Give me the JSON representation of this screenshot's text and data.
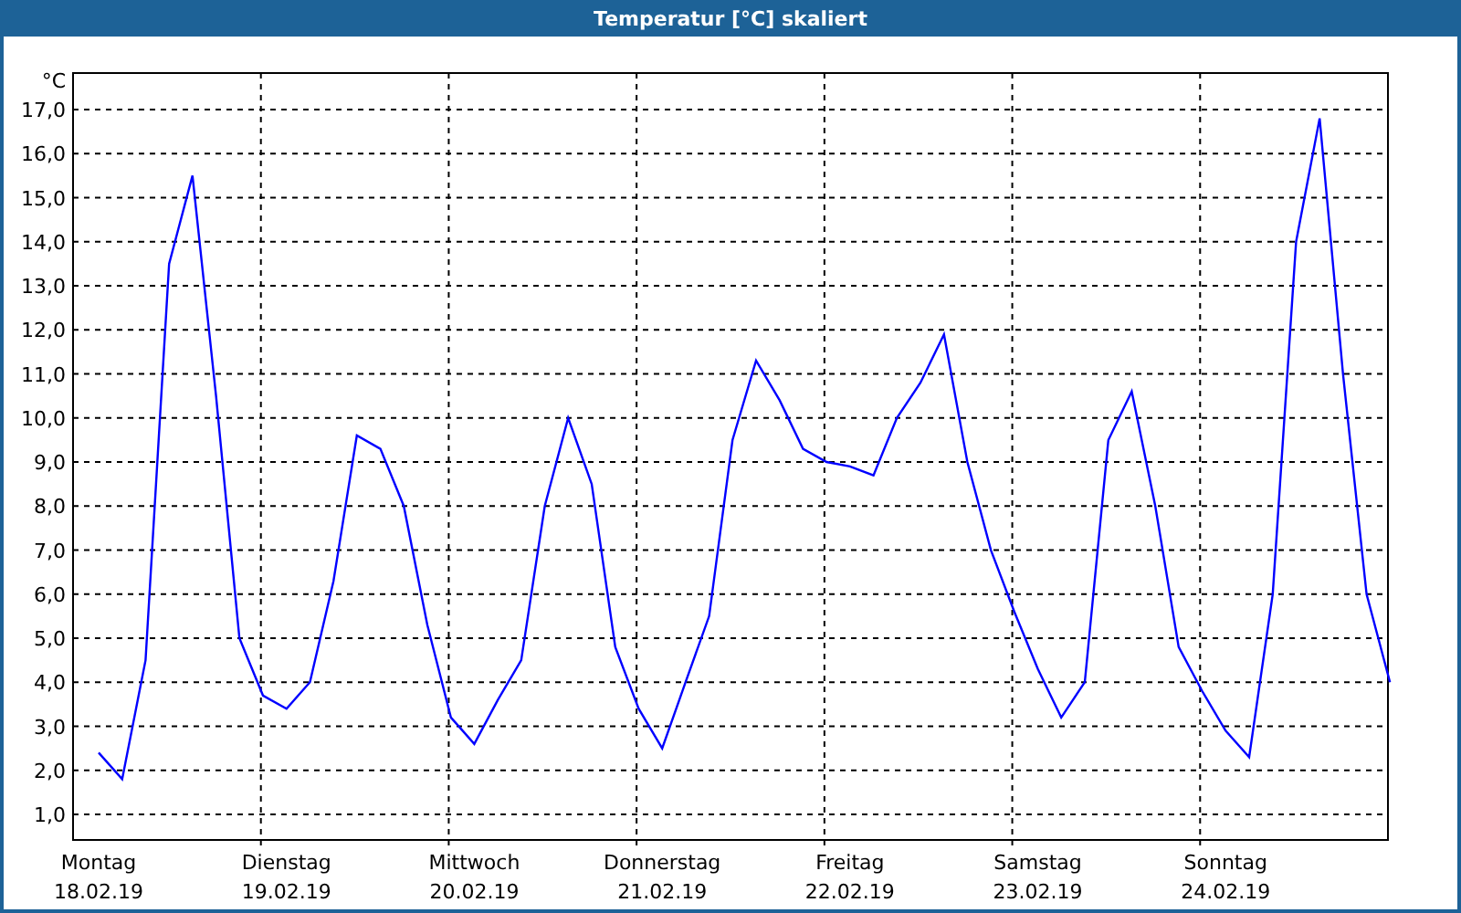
{
  "window": {
    "title": "Temperatur [°C] skaliert"
  },
  "chart": {
    "chart_data": {
      "type": "line",
      "ylabel": "°C",
      "ylim": [
        0.42,
        17.83
      ],
      "yticks": [
        {
          "value": 1,
          "label": "1,0"
        },
        {
          "value": 2,
          "label": "2,0"
        },
        {
          "value": 3,
          "label": "3,0"
        },
        {
          "value": 4,
          "label": "4,0"
        },
        {
          "value": 5,
          "label": "5,0"
        },
        {
          "value": 6,
          "label": "6,0"
        },
        {
          "value": 7,
          "label": "7,0"
        },
        {
          "value": 8,
          "label": "8,0"
        },
        {
          "value": 9,
          "label": "9,0"
        },
        {
          "value": 10,
          "label": "10,0"
        },
        {
          "value": 11,
          "label": "11,0"
        },
        {
          "value": 12,
          "label": "12,0"
        },
        {
          "value": 13,
          "label": "13,0"
        },
        {
          "value": 14,
          "label": "14,0"
        },
        {
          "value": 15,
          "label": "15,0"
        },
        {
          "value": 16,
          "label": "16,0"
        },
        {
          "value": 17,
          "label": "17,0"
        }
      ],
      "categories": [
        "Montag\n18.02.19",
        null,
        null,
        null,
        null,
        null,
        null,
        null,
        "Dienstag\n19.02.19",
        null,
        null,
        null,
        null,
        null,
        null,
        null,
        "Mittwoch\n20.02.19",
        null,
        null,
        null,
        null,
        null,
        null,
        null,
        "Donnerstag\n21.02.19",
        null,
        null,
        null,
        null,
        null,
        null,
        null,
        "Freitag\n22.02.19",
        null,
        null,
        null,
        null,
        null,
        null,
        null,
        "Samstag\n23.02.19",
        null,
        null,
        null,
        null,
        null,
        null,
        null,
        "Sonntag\n24.02.19",
        null,
        null,
        null,
        null,
        null,
        null,
        null
      ],
      "grid": true,
      "series": [
        {
          "color": "#0000ff",
          "values": [
            2.4,
            1.8,
            4.5,
            13.5,
            15.5,
            10.5,
            5.0,
            3.7,
            3.4,
            4.0,
            6.3,
            9.6,
            9.3,
            8.0,
            5.3,
            3.2,
            2.6,
            3.6,
            4.5,
            8.0,
            10.0,
            8.5,
            4.8,
            3.4,
            2.5,
            4.0,
            5.5,
            9.5,
            11.3,
            10.4,
            9.3,
            9.0,
            8.9,
            8.7,
            10.0,
            10.8,
            11.9,
            9.0,
            7.0,
            5.6,
            4.3,
            3.2,
            4.0,
            9.5,
            10.6,
            8.0,
            4.8,
            3.8,
            2.9,
            2.3,
            6.0,
            14.0,
            16.8,
            11.0,
            6.0,
            4.0
          ]
        }
      ]
    }
  }
}
